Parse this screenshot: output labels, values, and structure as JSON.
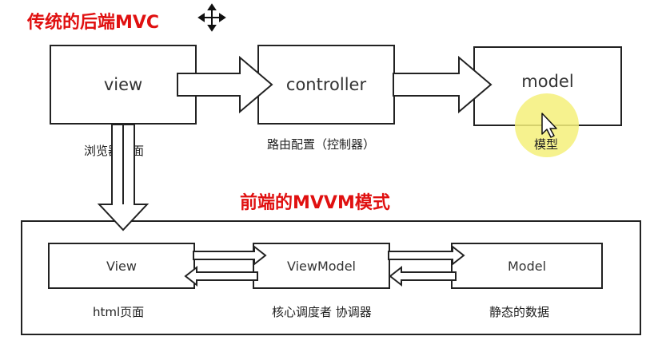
{
  "traditional": {
    "title": "传统的后端MVC",
    "boxes": [
      {
        "label": "view",
        "caption": "浏览器页面"
      },
      {
        "label": "controller",
        "caption": "路由配置（控制器）"
      },
      {
        "label": "model",
        "caption": "模型"
      }
    ]
  },
  "frontend": {
    "title": "前端的MVVM模式",
    "boxes": [
      {
        "label": "View",
        "caption": "html页面"
      },
      {
        "label": "ViewModel",
        "caption": "核心调度者 协调器"
      },
      {
        "label": "Model",
        "caption": "静态的数据"
      }
    ]
  },
  "colors": {
    "title": "#e01010",
    "cursor_highlight": "#f5f07a"
  },
  "icons": [
    "move-cursor-icon",
    "pointer-cursor-icon"
  ]
}
